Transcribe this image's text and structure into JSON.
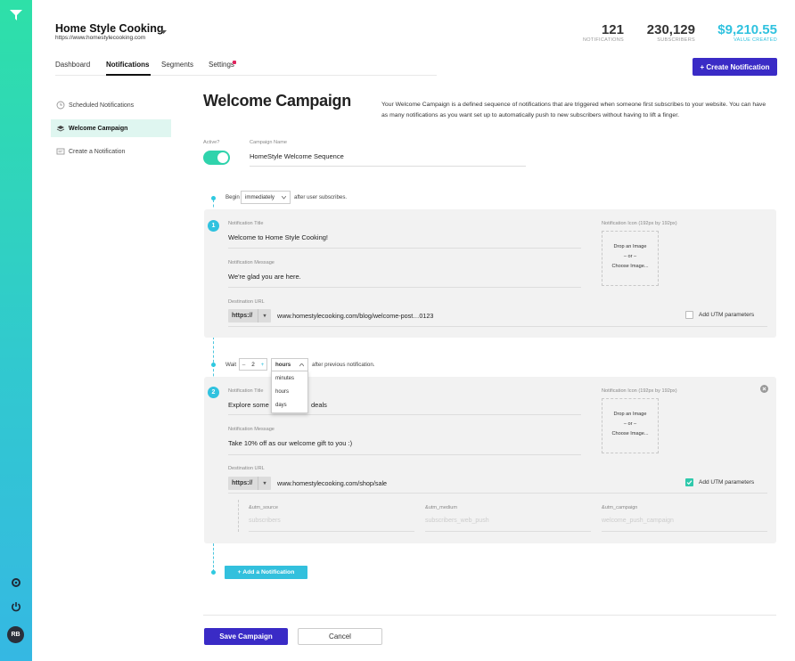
{
  "site": {
    "title": "Home Style Cooking",
    "url": "https://www.homestylecooking.com"
  },
  "stats": [
    {
      "value": "121",
      "label": "NOTIFICATIONS"
    },
    {
      "value": "230,129",
      "label": "SUBSCRIBERS"
    },
    {
      "value": "$9,210.55",
      "label": "VALUE CREATED"
    }
  ],
  "tabs": [
    "Dashboard",
    "Notifications",
    "Segments",
    "Settings"
  ],
  "create_button": "+ Create Notification",
  "sidebar": [
    "Scheduled Notifications",
    "Welcome Campaign",
    "Create a Notification"
  ],
  "page_title": "Welcome Campaign",
  "description": "Your Welcome Campaign is a defined sequence of notifications that are triggered when someone first subscribes to your website. You can have as many notifications as you want set up to automatically push to new subscribers without having to lift a finger.",
  "active_label": "Active?",
  "campaign_name": {
    "label": "Campaign Name",
    "value": "HomeStyle Welcome Sequence"
  },
  "begin": {
    "prefix": "Begin",
    "value": "immediately",
    "suffix": "after user subscribes."
  },
  "n1": {
    "number": "1",
    "title_label": "Notification Title",
    "title": "Welcome to Home Style Cooking!",
    "msg_label": "Notification Message",
    "msg": "We're glad you are here.",
    "url_label": "Destination URL",
    "protocol": "https://",
    "url": "www.homestylecooking.com/blog/welcome-post…0123",
    "icon_label": "Notification Icon (192px by 192px)",
    "drop_1": "Drop an Image",
    "drop_2": "– or –",
    "drop_3": "Choose Image...",
    "utm_label": "Add UTM parameters"
  },
  "wait": {
    "prefix": "Wait",
    "minus": "–",
    "value": "2",
    "plus": "+",
    "unit": "hours",
    "suffix": "after previous notification.",
    "options": [
      "minutes",
      "hours",
      "days"
    ]
  },
  "n2": {
    "number": "2",
    "title_label": "Notification Title",
    "title_visible_a": "Explore some",
    "title_visible_b": "deals",
    "msg_label": "Notification Message",
    "msg": "Take 10% off as our welcome gift to you :)",
    "url_label": "Destination URL",
    "protocol": "https://",
    "url": "www.homestylecooking.com/shop/sale",
    "icon_label": "Notification Icon (192px by 192px)",
    "drop_1": "Drop an Image",
    "drop_2": "– or –",
    "drop_3": "Choose Image...",
    "utm_label": "Add UTM parameters",
    "utm": [
      {
        "label": "&utm_source",
        "placeholder": "subscribers"
      },
      {
        "label": "&utm_medium",
        "placeholder": "subscribers_web_push"
      },
      {
        "label": "&utm_campaign",
        "placeholder": "welcome_push_campaign"
      }
    ]
  },
  "add_button": "+ Add a Notification",
  "save_button": "Save Campaign",
  "cancel_button": "Cancel",
  "avatar": "RB",
  "colors": {
    "accent_green": "#2fd3ac",
    "accent_cyan": "#30c2df",
    "brand_purple": "#3a2bc6"
  }
}
